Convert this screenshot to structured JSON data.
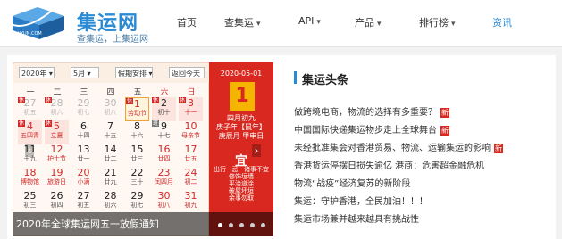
{
  "header": {
    "logo_title": "集运网",
    "logo_slogan": "查集运，上集运网",
    "logo_badge": "JIYUN.COM",
    "nav": [
      {
        "label": "首页",
        "has_caret": false
      },
      {
        "label": "查集运",
        "has_caret": true
      },
      {
        "label": "API",
        "has_caret": true
      },
      {
        "label": "产品",
        "has_caret": true
      },
      {
        "label": "排行榜",
        "has_caret": true
      },
      {
        "label": "资讯",
        "has_caret": false,
        "active": true
      }
    ]
  },
  "calendar": {
    "year_select": "2020年",
    "month_select": "5月",
    "holiday_select": "假期安排",
    "today_button": "返回今天",
    "weekdays": [
      "一",
      "二",
      "三",
      "四",
      "五",
      "六",
      "日"
    ],
    "rows": [
      [
        {
          "n": "27",
          "l": "初五",
          "grey": true,
          "tag": "休"
        },
        {
          "n": "28",
          "l": "初六",
          "grey": true,
          "tag": "休"
        },
        {
          "n": "29",
          "l": "初七",
          "grey": true
        },
        {
          "n": "30",
          "l": "初八",
          "grey": true
        },
        {
          "n": "1",
          "l": "劳动节",
          "red": true,
          "today": true,
          "hol": true,
          "tag": "休"
        },
        {
          "n": "2",
          "l": "初十",
          "hol": true,
          "tag": "休"
        },
        {
          "n": "3",
          "l": "十一",
          "red": true,
          "hol": true,
          "tag": "休"
        }
      ],
      [
        {
          "n": "4",
          "l": "五四青",
          "red": true,
          "hol": true,
          "tag": "休"
        },
        {
          "n": "5",
          "l": "立夏",
          "red": true,
          "hol": true,
          "tag": "休"
        },
        {
          "n": "6",
          "l": "十四"
        },
        {
          "n": "7",
          "l": "十五"
        },
        {
          "n": "8",
          "l": "十六"
        },
        {
          "n": "9",
          "l": "十七",
          "tag": "班",
          "ban": true
        },
        {
          "n": "10",
          "l": "母亲节",
          "red": true
        }
      ],
      [
        {
          "n": "11",
          "l": "十九"
        },
        {
          "n": "12",
          "l": "护士节",
          "red": true
        },
        {
          "n": "13",
          "l": "廿一"
        },
        {
          "n": "14",
          "l": "廿二"
        },
        {
          "n": "15",
          "l": "廿三"
        },
        {
          "n": "16",
          "l": "廿四",
          "red": true
        },
        {
          "n": "17",
          "l": "廿五",
          "red": true
        }
      ],
      [
        {
          "n": "18",
          "l": "博物馆",
          "red": true
        },
        {
          "n": "19",
          "l": "旅游日",
          "red": true
        },
        {
          "n": "20",
          "l": "小满",
          "red": true
        },
        {
          "n": "21",
          "l": "廿九"
        },
        {
          "n": "22",
          "l": "三十"
        },
        {
          "n": "23",
          "l": "闰四月",
          "red": true
        },
        {
          "n": "24",
          "l": "初二",
          "red": true
        }
      ],
      [
        {
          "n": "25",
          "l": "初三"
        },
        {
          "n": "26",
          "l": "初四"
        },
        {
          "n": "27",
          "l": "初五"
        },
        {
          "n": "28",
          "l": "初六"
        },
        {
          "n": "29",
          "l": "初七"
        },
        {
          "n": "30",
          "l": "初八",
          "red": true
        },
        {
          "n": "31",
          "l": "初九",
          "red": true
        }
      ]
    ],
    "side": {
      "date": "2020-05-01",
      "day": "1",
      "lunar_1": "四月初九",
      "lunar_2": "庚子年【鼠年】",
      "lunar_3": "庚辰月 甲申日",
      "yi": "宜",
      "ji": "忌",
      "yi_items": [
        "出行",
        "修饰垣墙",
        "平治道涂",
        "破屋坏垣",
        "余事勿取"
      ],
      "ji_items": [
        "诸事不宜"
      ]
    }
  },
  "slider": {
    "caption": "2020年全球集运网五一放假通知",
    "dot_count": 5,
    "active_dot": 0
  },
  "news": {
    "section_title": "集运头条",
    "new_label": "新",
    "items": [
      {
        "text": "做跨境电商，物流的选择有多重要？",
        "is_new": true
      },
      {
        "text": "中国国际快递集运物步走上全球舞台",
        "is_new": true
      },
      {
        "text": "未经批准集会对香港贸易、物流、运输集运的影响",
        "is_new": true
      },
      {
        "text": "香港货运停摆日损失逾亿 港商：危害超金融危机",
        "is_new": false
      },
      {
        "text": "物流“战疫”经济复苏的新阶段",
        "is_new": false
      },
      {
        "text": "集运：守护香港，全民加油！！！",
        "is_new": false
      },
      {
        "text": "集运市场兼并越来越具有挑战性",
        "is_new": false
      }
    ]
  },
  "colors": {
    "brand": "#2a8ad4",
    "calendar_red": "#d9281f",
    "day_box": "#f5b400"
  }
}
